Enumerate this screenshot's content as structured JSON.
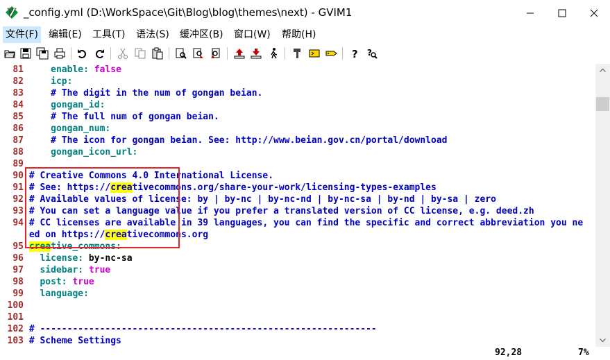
{
  "window": {
    "title": "_config.yml (D:\\WorkSpace\\Git\\Blog\\blog\\themes\\next) - GVIM1"
  },
  "menu": [
    {
      "label": "文件(F)"
    },
    {
      "label": "编辑(E)"
    },
    {
      "label": "工具(T)"
    },
    {
      "label": "语法(S)"
    },
    {
      "label": "缓冲区(B)"
    },
    {
      "label": "窗口(W)"
    },
    {
      "label": "帮助(H)"
    }
  ],
  "toolbar": {
    "icons": [
      "open-icon",
      "save-icon",
      "save-all-icon",
      "print-icon",
      "undo-icon",
      "redo-icon",
      "cut-icon",
      "copy-icon",
      "paste-icon",
      "find-replace-icon",
      "find-next-icon",
      "find-prev-icon",
      "load-session-icon",
      "save-session-icon",
      "run-script-icon",
      "make-icon",
      "shell-icon",
      "ctags-icon",
      "help-icon",
      "find-help-icon"
    ]
  },
  "editor": {
    "lines": [
      {
        "n": "81",
        "segs": [
          [
            "    ",
            ""
          ],
          [
            "enable:",
            "key"
          ],
          [
            " ",
            ""
          ],
          [
            "false",
            "bool"
          ]
        ]
      },
      {
        "n": "82",
        "segs": [
          [
            "    ",
            ""
          ],
          [
            "icp:",
            "key"
          ]
        ]
      },
      {
        "n": "83",
        "segs": [
          [
            "    ",
            ""
          ],
          [
            "# The digit in the num of gongan beian.",
            "cmt"
          ]
        ]
      },
      {
        "n": "84",
        "segs": [
          [
            "    ",
            ""
          ],
          [
            "gongan_id:",
            "key"
          ]
        ]
      },
      {
        "n": "85",
        "segs": [
          [
            "    ",
            ""
          ],
          [
            "# The full num of gongan beian.",
            "cmt"
          ]
        ]
      },
      {
        "n": "86",
        "segs": [
          [
            "    ",
            ""
          ],
          [
            "gongan_num:",
            "key"
          ]
        ]
      },
      {
        "n": "87",
        "segs": [
          [
            "    ",
            ""
          ],
          [
            "# The icon for gongan beian. See: http://www.beian.gov.cn/portal/download",
            "cmt"
          ]
        ]
      },
      {
        "n": "88",
        "segs": [
          [
            "    ",
            ""
          ],
          [
            "gongan_icon_url:",
            "key"
          ]
        ]
      },
      {
        "n": "89",
        "segs": []
      },
      {
        "n": "90",
        "segs": [
          [
            "# Creative Commons 4.0 International License.",
            "cmt"
          ]
        ]
      },
      {
        "n": "91",
        "segs": [
          [
            "# See: https://",
            "cmt"
          ],
          [
            "crea",
            "cmt hl"
          ],
          [
            "tivecommons.org/share-your-work/licensing-types-examples",
            "cmt"
          ]
        ]
      },
      {
        "n": "92",
        "segs": [
          [
            "# Available values of license: by | by-nc | by-nc-nd | by-nc-sa | by-nd | by-sa | zero",
            "cmt"
          ]
        ]
      },
      {
        "n": "93",
        "segs": [
          [
            "# You can set a language value if you prefer a translated version of CC license, e.g. deed.zh",
            "cmt"
          ]
        ]
      },
      {
        "n": "94",
        "segs": [
          [
            "# CC licenses are available in 39 languages, you can find the specific and correct abbreviation you ne",
            "cmt"
          ]
        ]
      },
      {
        "n": "",
        "segs": [
          [
            "ed on https://",
            "cmt"
          ],
          [
            "crea",
            "cmt hl"
          ],
          [
            "tivecommons.org",
            "cmt"
          ]
        ]
      },
      {
        "n": "95",
        "segs": [
          [
            "crea",
            "key hl"
          ],
          [
            "tive_commons:",
            "key"
          ]
        ]
      },
      {
        "n": "96",
        "segs": [
          [
            "  ",
            ""
          ],
          [
            "license:",
            "key"
          ],
          [
            " by-nc-sa",
            "str"
          ]
        ]
      },
      {
        "n": "97",
        "segs": [
          [
            "  ",
            ""
          ],
          [
            "sidebar:",
            "key"
          ],
          [
            " ",
            ""
          ],
          [
            "true",
            "bool"
          ]
        ]
      },
      {
        "n": "98",
        "segs": [
          [
            "  ",
            ""
          ],
          [
            "post:",
            "key"
          ],
          [
            " ",
            ""
          ],
          [
            "true",
            "bool"
          ]
        ]
      },
      {
        "n": "99",
        "segs": [
          [
            "  ",
            ""
          ],
          [
            "language:",
            "key"
          ]
        ]
      },
      {
        "n": "100",
        "segs": []
      },
      {
        "n": "101",
        "segs": []
      },
      {
        "n": "102",
        "segs": [
          [
            "# --------------------------------------------------------------",
            "cmt"
          ]
        ]
      },
      {
        "n": "103",
        "segs": [
          [
            "# Scheme Settings",
            "cmt"
          ]
        ]
      }
    ]
  },
  "status": {
    "position": "92,28",
    "percent": "7%"
  }
}
